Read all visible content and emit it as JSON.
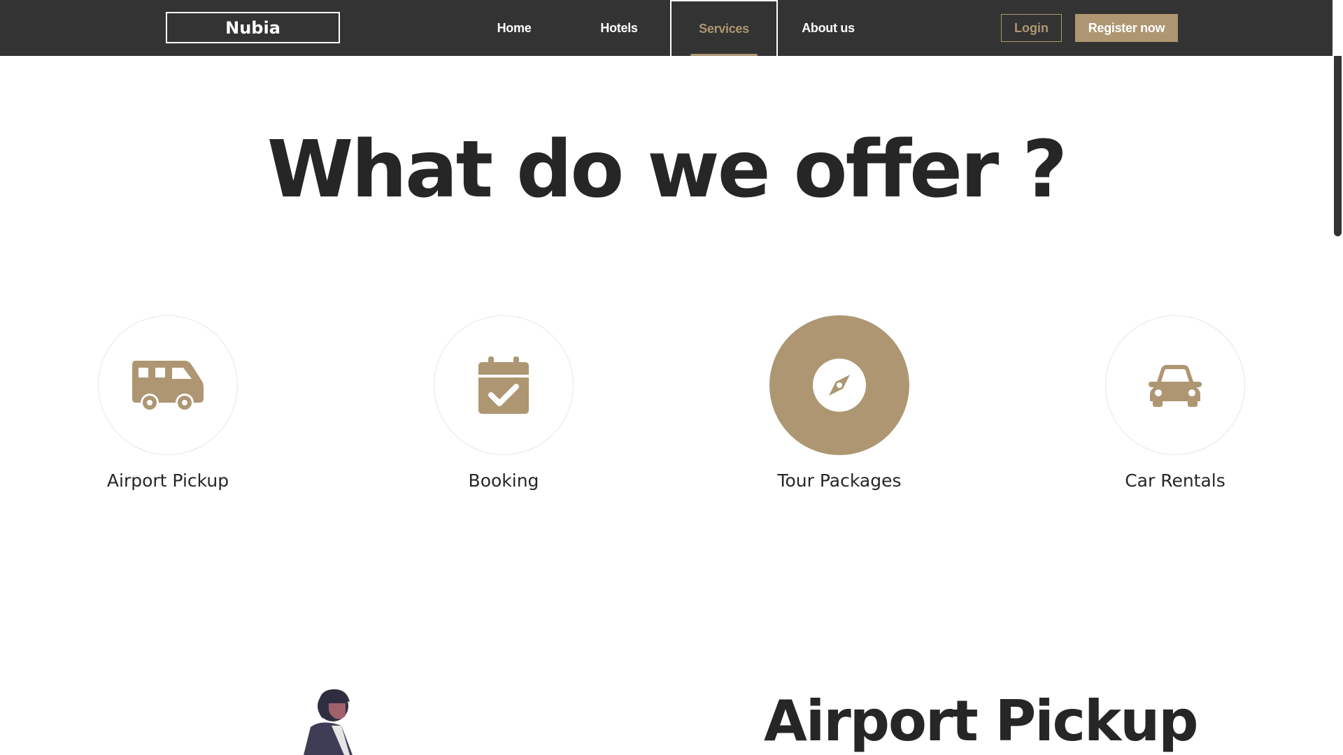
{
  "navbar": {
    "brand": "Nubia",
    "links": [
      {
        "label": "Home"
      },
      {
        "label": "Hotels"
      },
      {
        "label": "Services",
        "active": true
      },
      {
        "label": "About us"
      }
    ],
    "login_label": "Login",
    "register_label": "Register now"
  },
  "main": {
    "title": "What do we offer ?",
    "services": [
      {
        "label": "Airport Pickup",
        "icon": "shuttle-van-icon"
      },
      {
        "label": "Booking",
        "icon": "calendar-check-icon"
      },
      {
        "label": "Tour Packages",
        "icon": "compass-icon",
        "active": true
      },
      {
        "label": "Car Rentals",
        "icon": "car-icon"
      }
    ],
    "detail_heading": "Airport Pickup"
  },
  "colors": {
    "navbar_bg": "#333333",
    "accent": "#ad9671",
    "text": "#262626",
    "circle_border": "#e6e6e6"
  }
}
